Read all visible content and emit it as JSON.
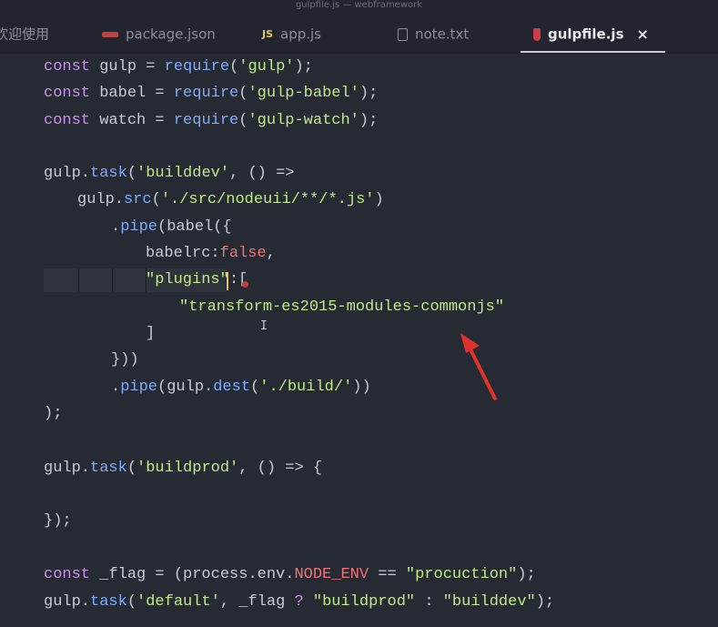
{
  "window": {
    "title": "gulpfile.js — webframework"
  },
  "tabs": [
    {
      "label": "欢迎使用",
      "icon": "none",
      "active": false
    },
    {
      "label": "package.json",
      "icon": "package-icon",
      "active": false
    },
    {
      "label": "app.js",
      "icon": "js-file-icon",
      "icon_text": "JS",
      "active": false
    },
    {
      "label": "note.txt",
      "icon": "text-file-icon",
      "active": false
    },
    {
      "label": "gulpfile.js",
      "icon": "gulp-icon",
      "active": true,
      "close": "×"
    }
  ],
  "code": {
    "l1": {
      "kw": "const",
      "name": " gulp = ",
      "fn": "require",
      "open": "(",
      "str": "'gulp'",
      "close": ");"
    },
    "l2": {
      "kw": "const",
      "name": " babel = ",
      "fn": "require",
      "open": "(",
      "str": "'gulp-babel'",
      "close": ");"
    },
    "l3": {
      "kw": "const",
      "name": " watch = ",
      "fn": "require",
      "open": "(",
      "str": "'gulp-watch'",
      "close": ");"
    },
    "l5": {
      "obj": "gulp.",
      "fn": "task",
      "open": "(",
      "str": "'builddev'",
      "rest": ", () =>"
    },
    "l6": {
      "obj": "gulp.",
      "fn": "src",
      "open": "(",
      "str": "'./src/nodeuii/**/*.js'",
      "close": ")"
    },
    "l7": {
      "obj": ".",
      "fn": "pipe",
      "rest": "(babel({"
    },
    "l8": {
      "key": "babelrc:",
      "bool": "false",
      "rest": ","
    },
    "l9": {
      "str": "\"plugins\"",
      "rest": ":["
    },
    "l10": {
      "str": "\"transform-es2015-modules-commonjs\""
    },
    "l11": {
      "rest": "]"
    },
    "l12": {
      "rest": "}))"
    },
    "l13": {
      "obj": ".",
      "fn": "pipe",
      "open": "(gulp.",
      "fn2": "dest",
      "open2": "(",
      "str": "'./build/'",
      "close": "))"
    },
    "l14": {
      "rest": ");"
    },
    "l16": {
      "obj": "gulp.",
      "fn": "task",
      "open": "(",
      "str": "'buildprod'",
      "rest": ", () => {"
    },
    "l18": {
      "rest": "});"
    },
    "l20": {
      "kw": "const",
      "name": " _flag = (process.env.",
      "env": "NODE_ENV",
      "op": " == ",
      "str": "\"procuction\"",
      "close": ");"
    },
    "l21": {
      "obj": "gulp.",
      "fn": "task",
      "open": "(",
      "str": "'default'",
      "mid": ", _flag ",
      "op": "?",
      "str2": " \"buildprod\" ",
      "op2": ":",
      "str3": " \"builddev\"",
      "close": ");"
    }
  },
  "colors": {
    "background": "#262a33",
    "keyword": "#c792ea",
    "function": "#82aaff",
    "string": "#c3e88d",
    "boolean": "#f07178",
    "annotation_arrow": "#e0322b"
  }
}
